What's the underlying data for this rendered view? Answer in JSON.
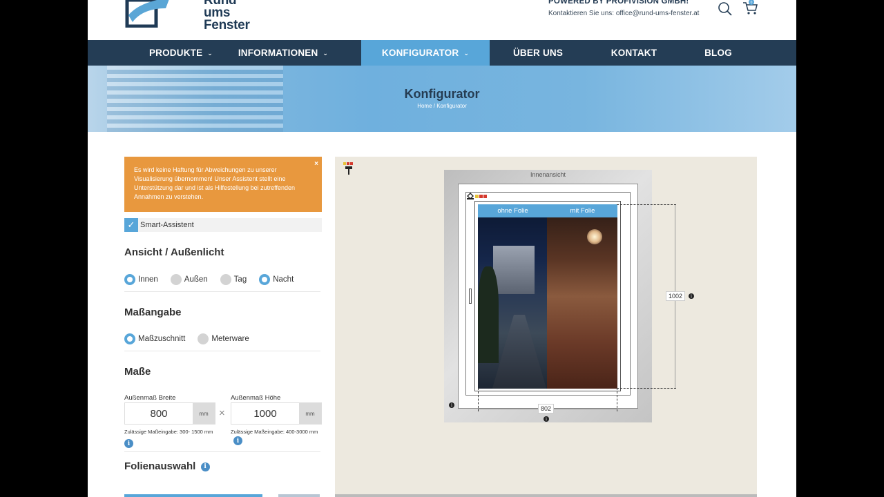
{
  "header": {
    "logo_lines": [
      "Rund",
      "ums",
      "Fenster"
    ],
    "company": "POWERED BY PROFIVISION GMBH!",
    "contact_line": "Kontaktieren Sie uns: office@rund-ums-fenster.at",
    "cart_count": "0"
  },
  "nav": {
    "items": [
      {
        "label": "PRODUKTE",
        "has_dropdown": true
      },
      {
        "label": "INFORMATIONEN",
        "has_dropdown": true
      },
      {
        "label": "KONFIGURATOR",
        "has_dropdown": true,
        "active": true
      },
      {
        "label": "ÜBER UNS"
      },
      {
        "label": "KONTAKT"
      },
      {
        "label": "BLOG"
      }
    ]
  },
  "banner": {
    "title": "Konfigurator",
    "breadcrumb": "Home / Konfigurator"
  },
  "notice": {
    "text": "Es wird keine Haftung für Abweichungen zu unserer Visualisierung übernommen! Unser Assistent stellt eine Unterstützung dar und ist als Hilfestellung bei zutreffenden Annahmen zu verstehen.",
    "close": "×"
  },
  "assistant": {
    "label": "Smart-Assistent",
    "checked": true
  },
  "view_section": {
    "heading": "Ansicht / Außenlicht",
    "options": [
      {
        "label": "Innen",
        "selected": true
      },
      {
        "label": "Außen",
        "selected": false
      },
      {
        "label": "Tag",
        "selected": false
      },
      {
        "label": "Nacht",
        "selected": true
      }
    ]
  },
  "measure_section": {
    "heading": "Maßangabe",
    "options": [
      {
        "label": "Maßzuschnitt",
        "selected": true
      },
      {
        "label": "Meterware",
        "selected": false
      }
    ]
  },
  "dimensions": {
    "heading": "Maße",
    "width_label": "Außenmaß Breite",
    "width_value": "800",
    "height_label": "Außenmaß Höhe",
    "height_value": "1000",
    "unit": "mm",
    "times": "×",
    "width_hint": "Zulässige Maßeingabe: 300- 1500 mm",
    "height_hint": "Zulässige Maßeingabe: 400-3000 mm"
  },
  "film_section": {
    "heading": "Folienauswahl"
  },
  "preview": {
    "frame_label": "Innenansicht",
    "tab_without": "ohne Folie",
    "tab_with": "mit Folie",
    "dim_height": "1002",
    "dim_width": "802",
    "info": "i"
  },
  "colors": {
    "nav_bg": "#243d55",
    "accent": "#58a6d9",
    "notice_bg": "#e8983e",
    "panel_bg": "#ede9df"
  }
}
